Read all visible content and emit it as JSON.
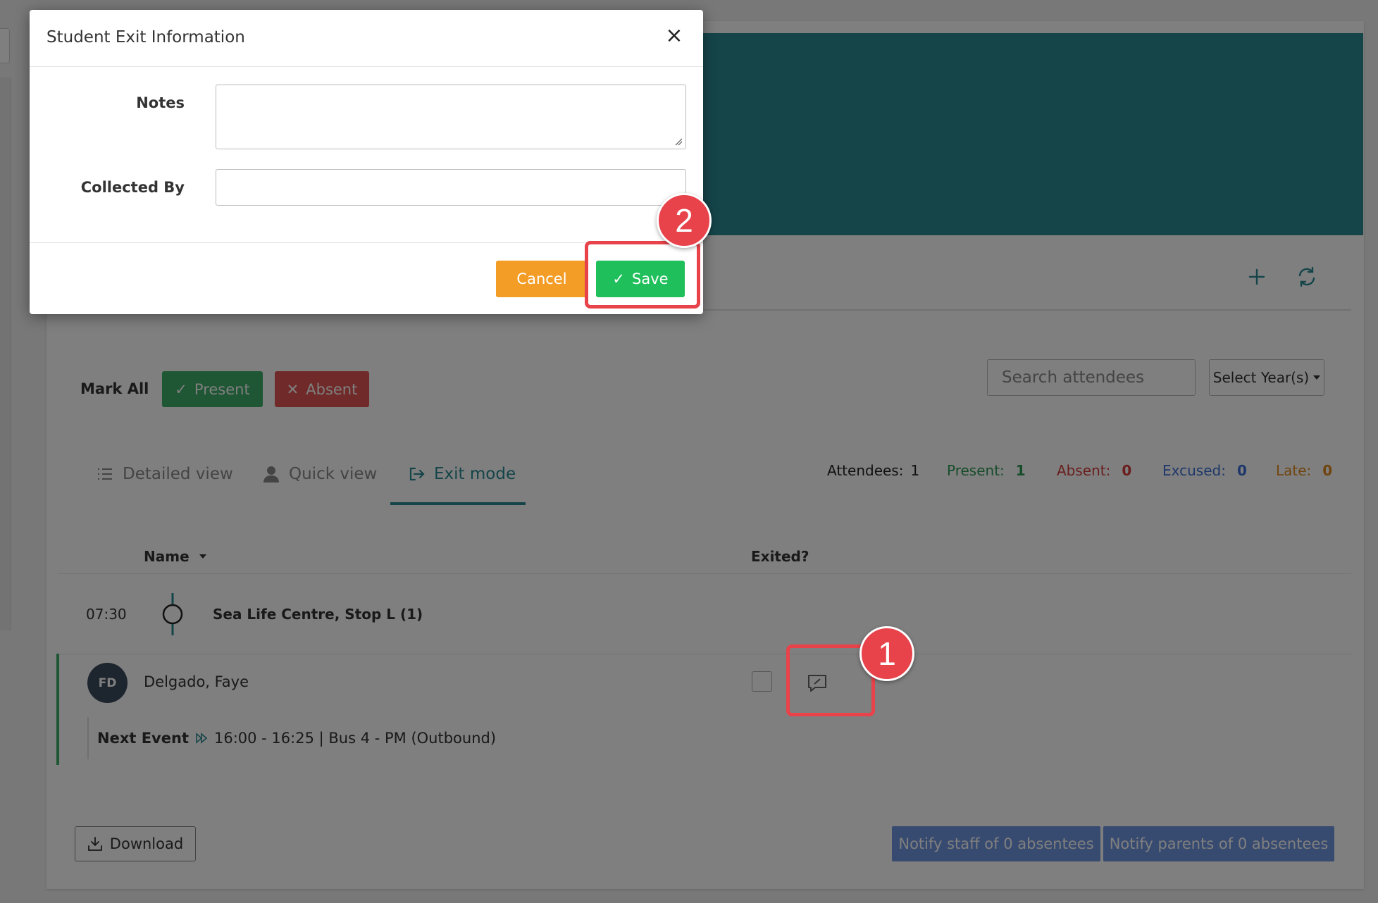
{
  "page": {
    "mark_all_label": "Mark All",
    "present_label": "Present",
    "absent_label": "Absent",
    "search_placeholder": "Search attendees",
    "year_select_label": "Select Year(s)"
  },
  "tabs": [
    {
      "label": "Detailed view",
      "icon": "list-icon"
    },
    {
      "label": "Quick view",
      "icon": "person-icon"
    },
    {
      "label": "Exit mode",
      "icon": "exit-icon",
      "active": true
    }
  ],
  "stats": {
    "attendees_label": "Attendees:",
    "attendees_value": "1",
    "present_label": "Present:",
    "present_value": "1",
    "absent_label": "Absent:",
    "absent_value": "0",
    "excused_label": "Excused:",
    "excused_value": "0",
    "late_label": "Late:",
    "late_value": "0"
  },
  "table": {
    "col_name": "Name",
    "col_exited": "Exited?"
  },
  "stop": {
    "time": "07:30",
    "name": "Sea Life Centre, Stop L (1)"
  },
  "student": {
    "initials": "FD",
    "name": "Delgado, Faye",
    "next_event_label": "Next Event",
    "next_event_detail": "16:00 - 16:25 | Bus 4 - PM (Outbound)"
  },
  "footer": {
    "download_label": "Download",
    "notify_staff_label": "Notify staff of 0 absentees",
    "notify_parents_label": "Notify parents of 0 absentees"
  },
  "modal": {
    "title": "Student Exit Information",
    "close_symbol": "×",
    "notes_label": "Notes",
    "notes_value": "",
    "collected_by_label": "Collected By",
    "collected_by_value": "",
    "cancel_label": "Cancel",
    "save_label": "Save"
  },
  "annotations": {
    "step1": "1",
    "step2": "2"
  },
  "colors": {
    "teal": "#2a8a93",
    "save_green": "#1fbf5b",
    "cancel_orange": "#f39c26",
    "annotation_red": "#e8424b",
    "notify_blue": "#6e94e0"
  }
}
